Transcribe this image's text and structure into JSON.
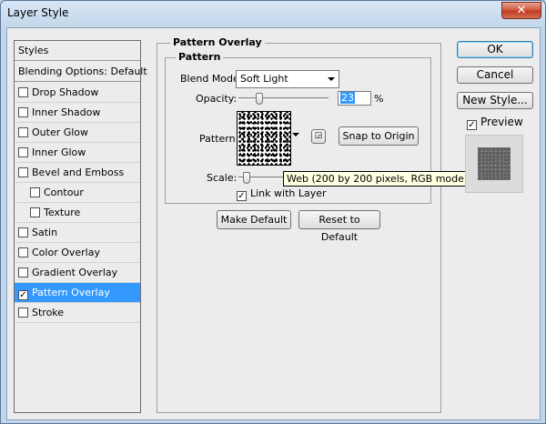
{
  "window": {
    "title": "Layer Style",
    "close_glyph": "✕"
  },
  "style_list": {
    "styles_label": "Styles",
    "blending_label": "Blending Options: Default",
    "items": [
      {
        "label": "Drop Shadow",
        "checked": false,
        "indent": false
      },
      {
        "label": "Inner Shadow",
        "checked": false,
        "indent": false
      },
      {
        "label": "Outer Glow",
        "checked": false,
        "indent": false
      },
      {
        "label": "Inner Glow",
        "checked": false,
        "indent": false
      },
      {
        "label": "Bevel and Emboss",
        "checked": false,
        "indent": false
      },
      {
        "label": "Contour",
        "checked": false,
        "indent": true
      },
      {
        "label": "Texture",
        "checked": false,
        "indent": true
      },
      {
        "label": "Satin",
        "checked": false,
        "indent": false
      },
      {
        "label": "Color Overlay",
        "checked": false,
        "indent": false
      },
      {
        "label": "Gradient Overlay",
        "checked": false,
        "indent": false
      },
      {
        "label": "Pattern Overlay",
        "checked": true,
        "indent": false,
        "selected": true
      },
      {
        "label": "Stroke",
        "checked": false,
        "indent": false
      }
    ]
  },
  "pattern_overlay": {
    "group_title": "Pattern Overlay",
    "sub_group_title": "Pattern",
    "blend_mode_label": "Blend Mode:",
    "blend_mode_value": "Soft Light",
    "opacity_label": "Opacity:",
    "opacity_value": "23",
    "opacity_unit": "%",
    "opacity_fraction": 0.23,
    "pattern_label": "Pattern:",
    "snap_button": "Snap to Origin",
    "scale_label": "Scale:",
    "tooltip": "Web (200 by 200 pixels, RGB mode)",
    "link_label": "Link with Layer",
    "link_checked": true,
    "make_default_button": "Make Default",
    "reset_default_button": "Reset to Default"
  },
  "actions": {
    "ok": "OK",
    "cancel": "Cancel",
    "new_style": "New Style...",
    "preview_label": "Preview",
    "preview_checked": true
  },
  "check_glyph": "✓"
}
